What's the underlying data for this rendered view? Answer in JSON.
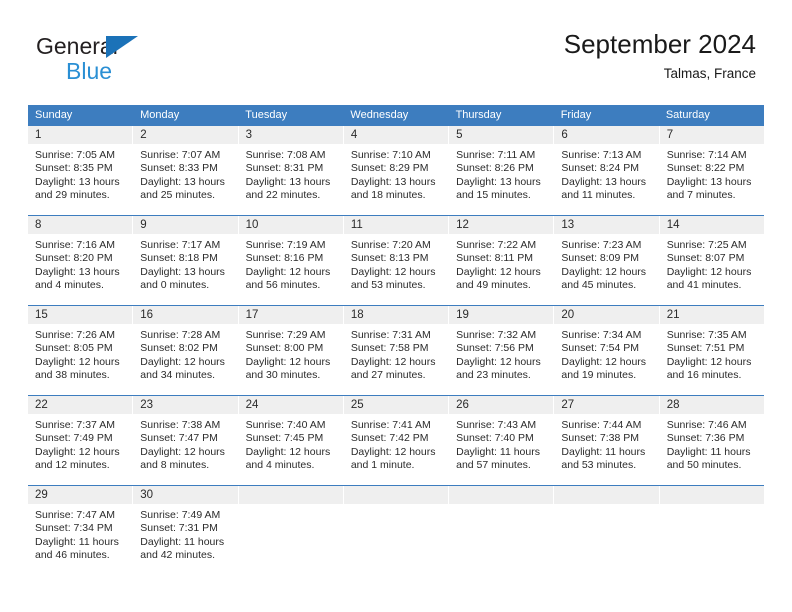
{
  "brand": {
    "name_top": "General",
    "name_bottom": "Blue",
    "triangle_color": "#1b72b8",
    "blue_text_color": "#2a8fd4"
  },
  "header": {
    "title": "September 2024",
    "subtitle": "Talmas, France"
  },
  "colors": {
    "header_blue": "#3d7dbf",
    "daynum_band": "#efefef",
    "text": "#2b2b2b"
  },
  "weekdays": [
    "Sunday",
    "Monday",
    "Tuesday",
    "Wednesday",
    "Thursday",
    "Friday",
    "Saturday"
  ],
  "weeks": [
    {
      "days": [
        {
          "num": "1",
          "sunrise": "Sunrise: 7:05 AM",
          "sunset": "Sunset: 8:35 PM",
          "daylight1": "Daylight: 13 hours",
          "daylight2": "and 29 minutes."
        },
        {
          "num": "2",
          "sunrise": "Sunrise: 7:07 AM",
          "sunset": "Sunset: 8:33 PM",
          "daylight1": "Daylight: 13 hours",
          "daylight2": "and 25 minutes."
        },
        {
          "num": "3",
          "sunrise": "Sunrise: 7:08 AM",
          "sunset": "Sunset: 8:31 PM",
          "daylight1": "Daylight: 13 hours",
          "daylight2": "and 22 minutes."
        },
        {
          "num": "4",
          "sunrise": "Sunrise: 7:10 AM",
          "sunset": "Sunset: 8:29 PM",
          "daylight1": "Daylight: 13 hours",
          "daylight2": "and 18 minutes."
        },
        {
          "num": "5",
          "sunrise": "Sunrise: 7:11 AM",
          "sunset": "Sunset: 8:26 PM",
          "daylight1": "Daylight: 13 hours",
          "daylight2": "and 15 minutes."
        },
        {
          "num": "6",
          "sunrise": "Sunrise: 7:13 AM",
          "sunset": "Sunset: 8:24 PM",
          "daylight1": "Daylight: 13 hours",
          "daylight2": "and 11 minutes."
        },
        {
          "num": "7",
          "sunrise": "Sunrise: 7:14 AM",
          "sunset": "Sunset: 8:22 PM",
          "daylight1": "Daylight: 13 hours",
          "daylight2": "and 7 minutes."
        }
      ]
    },
    {
      "days": [
        {
          "num": "8",
          "sunrise": "Sunrise: 7:16 AM",
          "sunset": "Sunset: 8:20 PM",
          "daylight1": "Daylight: 13 hours",
          "daylight2": "and 4 minutes."
        },
        {
          "num": "9",
          "sunrise": "Sunrise: 7:17 AM",
          "sunset": "Sunset: 8:18 PM",
          "daylight1": "Daylight: 13 hours",
          "daylight2": "and 0 minutes."
        },
        {
          "num": "10",
          "sunrise": "Sunrise: 7:19 AM",
          "sunset": "Sunset: 8:16 PM",
          "daylight1": "Daylight: 12 hours",
          "daylight2": "and 56 minutes."
        },
        {
          "num": "11",
          "sunrise": "Sunrise: 7:20 AM",
          "sunset": "Sunset: 8:13 PM",
          "daylight1": "Daylight: 12 hours",
          "daylight2": "and 53 minutes."
        },
        {
          "num": "12",
          "sunrise": "Sunrise: 7:22 AM",
          "sunset": "Sunset: 8:11 PM",
          "daylight1": "Daylight: 12 hours",
          "daylight2": "and 49 minutes."
        },
        {
          "num": "13",
          "sunrise": "Sunrise: 7:23 AM",
          "sunset": "Sunset: 8:09 PM",
          "daylight1": "Daylight: 12 hours",
          "daylight2": "and 45 minutes."
        },
        {
          "num": "14",
          "sunrise": "Sunrise: 7:25 AM",
          "sunset": "Sunset: 8:07 PM",
          "daylight1": "Daylight: 12 hours",
          "daylight2": "and 41 minutes."
        }
      ]
    },
    {
      "days": [
        {
          "num": "15",
          "sunrise": "Sunrise: 7:26 AM",
          "sunset": "Sunset: 8:05 PM",
          "daylight1": "Daylight: 12 hours",
          "daylight2": "and 38 minutes."
        },
        {
          "num": "16",
          "sunrise": "Sunrise: 7:28 AM",
          "sunset": "Sunset: 8:02 PM",
          "daylight1": "Daylight: 12 hours",
          "daylight2": "and 34 minutes."
        },
        {
          "num": "17",
          "sunrise": "Sunrise: 7:29 AM",
          "sunset": "Sunset: 8:00 PM",
          "daylight1": "Daylight: 12 hours",
          "daylight2": "and 30 minutes."
        },
        {
          "num": "18",
          "sunrise": "Sunrise: 7:31 AM",
          "sunset": "Sunset: 7:58 PM",
          "daylight1": "Daylight: 12 hours",
          "daylight2": "and 27 minutes."
        },
        {
          "num": "19",
          "sunrise": "Sunrise: 7:32 AM",
          "sunset": "Sunset: 7:56 PM",
          "daylight1": "Daylight: 12 hours",
          "daylight2": "and 23 minutes."
        },
        {
          "num": "20",
          "sunrise": "Sunrise: 7:34 AM",
          "sunset": "Sunset: 7:54 PM",
          "daylight1": "Daylight: 12 hours",
          "daylight2": "and 19 minutes."
        },
        {
          "num": "21",
          "sunrise": "Sunrise: 7:35 AM",
          "sunset": "Sunset: 7:51 PM",
          "daylight1": "Daylight: 12 hours",
          "daylight2": "and 16 minutes."
        }
      ]
    },
    {
      "days": [
        {
          "num": "22",
          "sunrise": "Sunrise: 7:37 AM",
          "sunset": "Sunset: 7:49 PM",
          "daylight1": "Daylight: 12 hours",
          "daylight2": "and 12 minutes."
        },
        {
          "num": "23",
          "sunrise": "Sunrise: 7:38 AM",
          "sunset": "Sunset: 7:47 PM",
          "daylight1": "Daylight: 12 hours",
          "daylight2": "and 8 minutes."
        },
        {
          "num": "24",
          "sunrise": "Sunrise: 7:40 AM",
          "sunset": "Sunset: 7:45 PM",
          "daylight1": "Daylight: 12 hours",
          "daylight2": "and 4 minutes."
        },
        {
          "num": "25",
          "sunrise": "Sunrise: 7:41 AM",
          "sunset": "Sunset: 7:42 PM",
          "daylight1": "Daylight: 12 hours",
          "daylight2": "and 1 minute."
        },
        {
          "num": "26",
          "sunrise": "Sunrise: 7:43 AM",
          "sunset": "Sunset: 7:40 PM",
          "daylight1": "Daylight: 11 hours",
          "daylight2": "and 57 minutes."
        },
        {
          "num": "27",
          "sunrise": "Sunrise: 7:44 AM",
          "sunset": "Sunset: 7:38 PM",
          "daylight1": "Daylight: 11 hours",
          "daylight2": "and 53 minutes."
        },
        {
          "num": "28",
          "sunrise": "Sunrise: 7:46 AM",
          "sunset": "Sunset: 7:36 PM",
          "daylight1": "Daylight: 11 hours",
          "daylight2": "and 50 minutes."
        }
      ]
    },
    {
      "days": [
        {
          "num": "29",
          "sunrise": "Sunrise: 7:47 AM",
          "sunset": "Sunset: 7:34 PM",
          "daylight1": "Daylight: 11 hours",
          "daylight2": "and 46 minutes."
        },
        {
          "num": "30",
          "sunrise": "Sunrise: 7:49 AM",
          "sunset": "Sunset: 7:31 PM",
          "daylight1": "Daylight: 11 hours",
          "daylight2": "and 42 minutes."
        },
        {
          "num": "",
          "sunrise": "",
          "sunset": "",
          "daylight1": "",
          "daylight2": ""
        },
        {
          "num": "",
          "sunrise": "",
          "sunset": "",
          "daylight1": "",
          "daylight2": ""
        },
        {
          "num": "",
          "sunrise": "",
          "sunset": "",
          "daylight1": "",
          "daylight2": ""
        },
        {
          "num": "",
          "sunrise": "",
          "sunset": "",
          "daylight1": "",
          "daylight2": ""
        },
        {
          "num": "",
          "sunrise": "",
          "sunset": "",
          "daylight1": "",
          "daylight2": ""
        }
      ]
    }
  ]
}
